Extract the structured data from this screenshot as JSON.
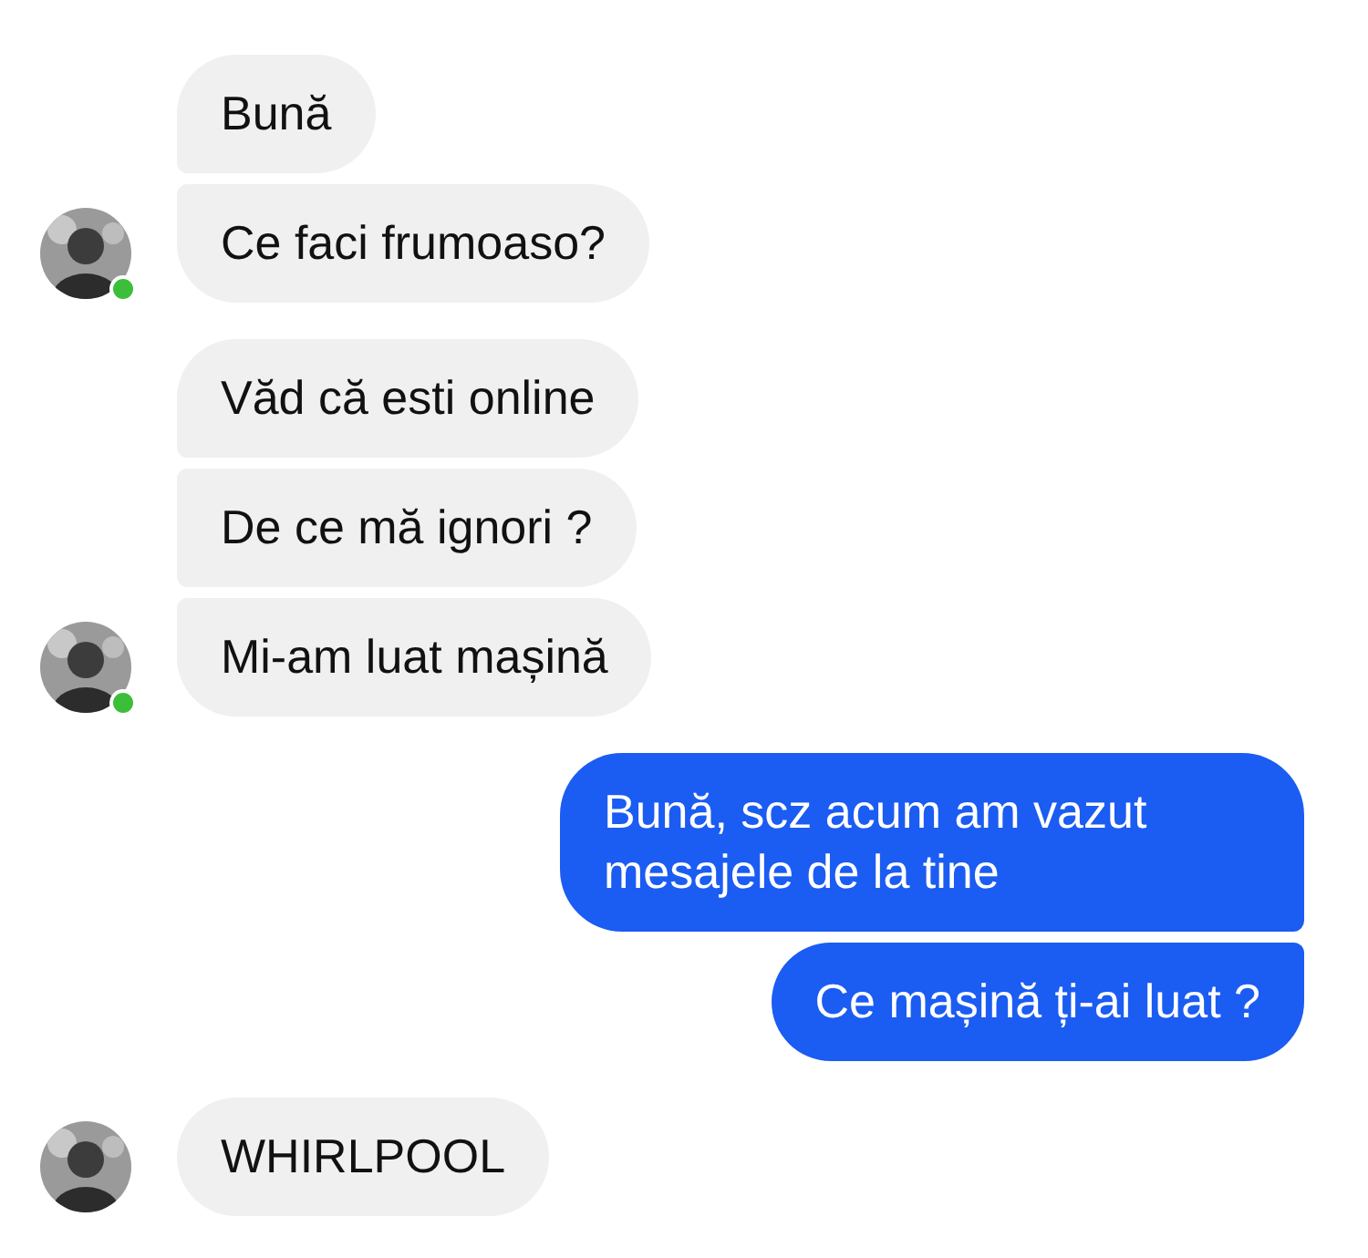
{
  "groups": [
    {
      "kind": "received",
      "online": true,
      "messages": [
        "Bună",
        "Ce faci frumoaso?"
      ]
    },
    {
      "kind": "received",
      "online": true,
      "messages": [
        "Văd că esti online",
        "De ce mă ignori  ?",
        "Mi-am luat mașină"
      ]
    },
    {
      "kind": "sent",
      "messages": [
        "Bună, scz acum am vazut mesajele de la tine",
        "Ce mașină ți-ai luat ?"
      ]
    },
    {
      "kind": "received",
      "messages": [
        "WHIRLPOOL"
      ]
    }
  ]
}
